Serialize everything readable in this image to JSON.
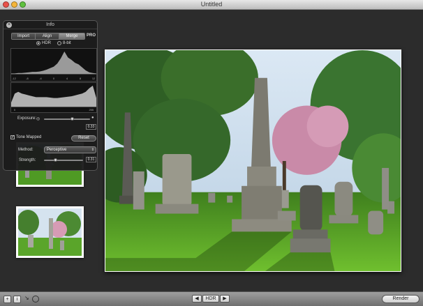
{
  "window": {
    "title": "Untitled"
  },
  "info_panel": {
    "title": "Info",
    "tabs": [
      "Import",
      "Align",
      "Merge"
    ],
    "active_tab": "Merge",
    "pro_label": "PRO",
    "bit_depth": {
      "hdr_label": "HDR",
      "eight_bit_label": "8-bit",
      "selected": "HDR"
    },
    "histogram_top": {
      "scale": [
        "-12",
        "-8",
        "-4",
        "0",
        "4",
        "8",
        "12"
      ],
      "bins": [
        2,
        2,
        3,
        3,
        4,
        5,
        6,
        6,
        7,
        9,
        12,
        16,
        20,
        28,
        42,
        60,
        44,
        38,
        30,
        26,
        18,
        10,
        5,
        3,
        2
      ]
    },
    "histogram_bottom": {
      "scale_min": "0",
      "scale_max": "255",
      "bins": [
        10,
        30,
        34,
        30,
        28,
        26,
        24,
        22,
        22,
        22,
        22,
        21,
        20,
        20,
        21,
        22,
        23,
        24,
        26,
        28,
        30,
        34,
        42,
        48,
        20
      ]
    },
    "exposure": {
      "label": "Exposure:",
      "value": "0.33",
      "fraction": 0.62
    },
    "tone_mapped": {
      "label": "Tone Mapped",
      "checked": true,
      "check_glyph": "✓"
    },
    "reset_label": "Reset",
    "method": {
      "label": "Method:",
      "value": "Perceptive"
    },
    "strength": {
      "label": "Strength:",
      "value": "0.31",
      "fraction": 0.31
    }
  },
  "bottom_toolbar": {
    "add_label": "+",
    "info_label": "i",
    "prev_label": "◀",
    "mode_label": "HDR",
    "next_label": "▶",
    "render_label": "Render"
  },
  "colors": {
    "panel_bg": "#1c1c1c",
    "grass": "#4a8a22",
    "sky": "#c9dcef",
    "blossom": "#c98aa8"
  }
}
